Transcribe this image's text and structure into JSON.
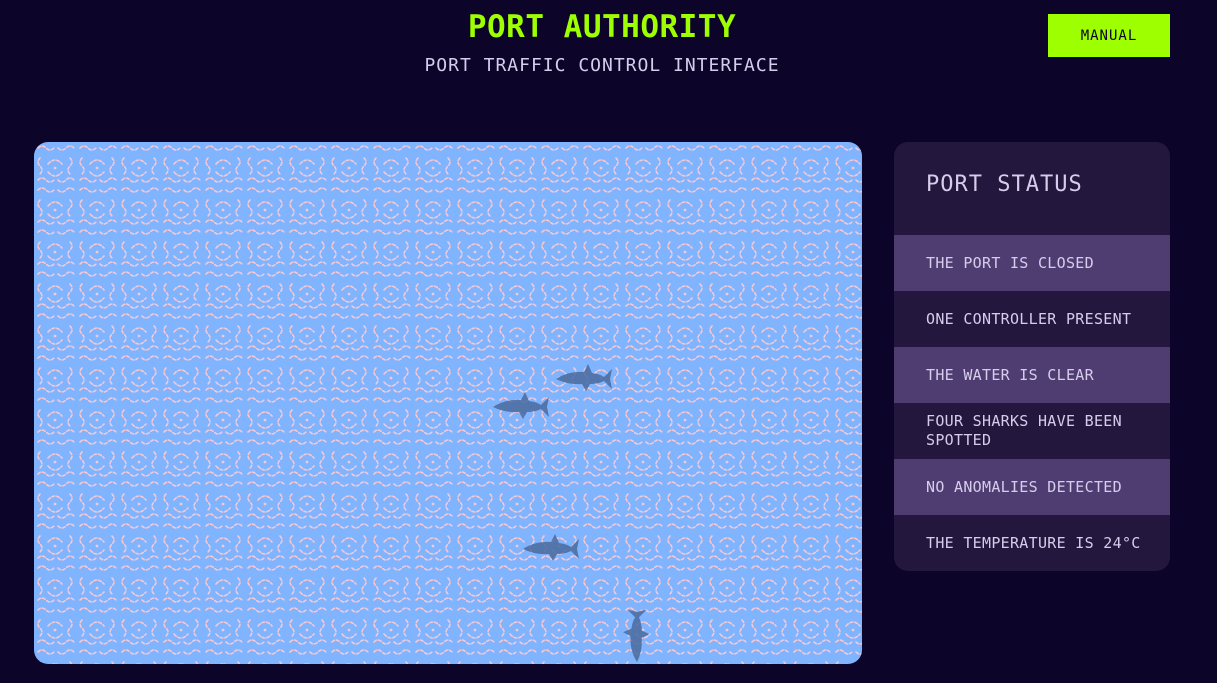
{
  "header": {
    "title": "PORT AUTHORITY",
    "subtitle": "PORT TRAFFIC CONTROL INTERFACE",
    "manual_label": "MANUAL"
  },
  "status": {
    "title": "PORT STATUS",
    "items": [
      "THE PORT IS CLOSED",
      "ONE CONTROLLER PRESENT",
      "THE WATER IS CLEAR",
      "FOUR SHARKS HAVE BEEN SPOTTED",
      "NO ANOMALIES DETECTED",
      "THE TEMPERATURE IS 24°C"
    ]
  },
  "colors": {
    "background": "#0d042a",
    "accent": "#9dff00",
    "water": "#80b4ff",
    "panel": "#23173d",
    "panel_row_alt": "#4f3d72",
    "shark": "#4a6a9e"
  },
  "icons": {
    "shark": "shark-icon"
  }
}
